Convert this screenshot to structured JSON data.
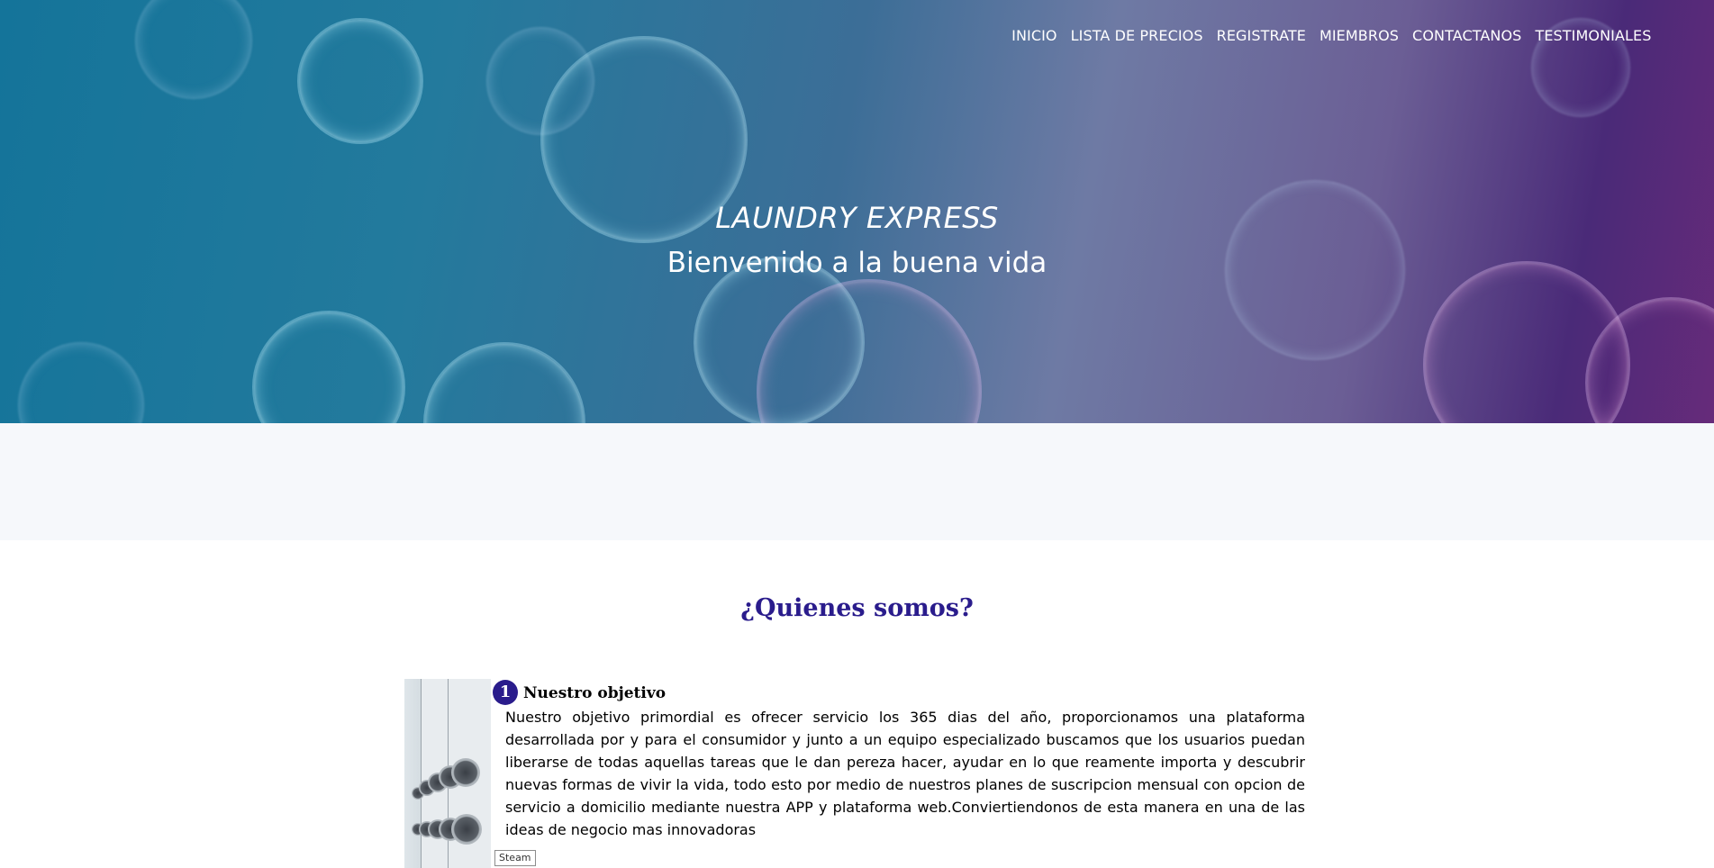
{
  "nav": {
    "items": [
      {
        "label": "INICIO"
      },
      {
        "label": "LISTA DE PRECIOS"
      },
      {
        "label": "REGISTRATE"
      },
      {
        "label": "MIEMBROS"
      },
      {
        "label": "CONTACTANOS"
      },
      {
        "label": "TESTIMONIALES"
      }
    ]
  },
  "hero": {
    "brand": "LAUNDRY EXPRESS",
    "tagline": "Bienvenido a la buena vida"
  },
  "about": {
    "title": "¿Quienes somos?",
    "objective": {
      "number": "1",
      "heading": "Nuestro objetivo",
      "text": "Nuestro objetivo primordial es ofrecer servicio los 365 dias del año, proporcionamos una plataforma desarrollada por y para el consumidor y junto a un equipo especializado buscamos que los usuarios puedan liberarse de todas aquellas tareas que le dan pereza hacer, ayudar en lo que reamente importa y descubrir nuevas formas de vivir la vida, todo esto por medio de nuestros planes  de suscripcion mensual con opcion de servicio a domicilio mediante nuestra APP y plataforma web.Conviertiendonos de esta manera en una de las ideas de negocio mas innovadoras",
      "image_caption": "Steam"
    }
  },
  "colors": {
    "accent": "#2a1c8c",
    "hero_blue": "#14749a",
    "hero_purple": "#4a2a78"
  }
}
